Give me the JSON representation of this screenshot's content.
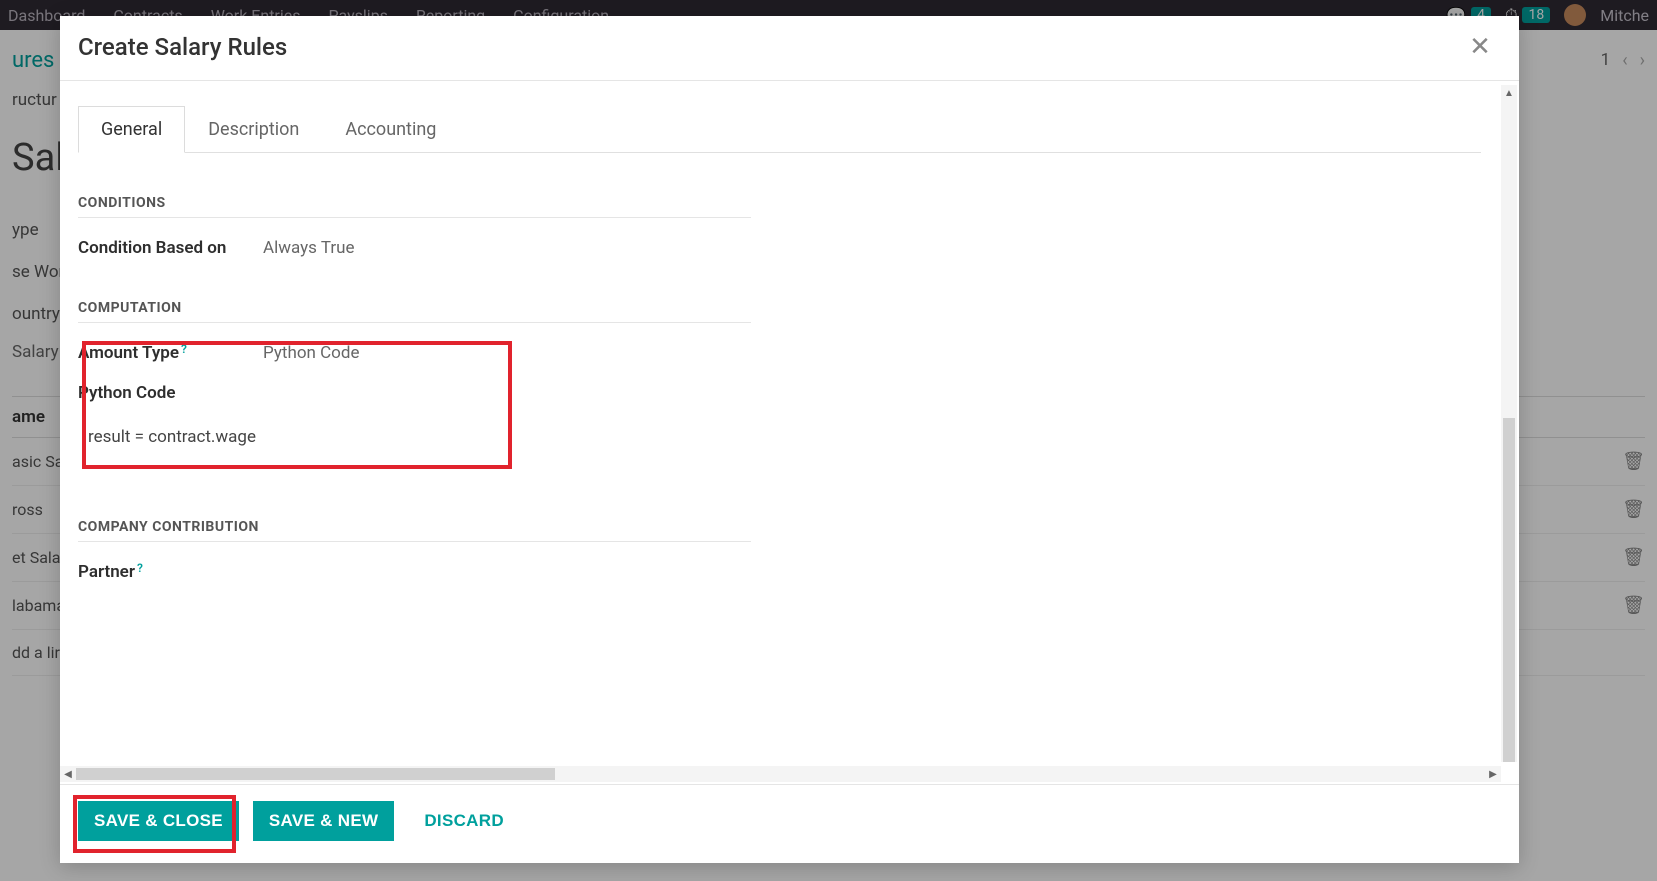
{
  "topnav": {
    "items": [
      "Dashboard",
      "Contracts",
      "Work Entries",
      "Payslips",
      "Reporting",
      "Configuration"
    ],
    "chat_badge": "4",
    "clock_badge": "18",
    "user_name": "Mitche"
  },
  "breadcrumb": {
    "link": "ures",
    "pager_page": "1"
  },
  "bg": {
    "labels": [
      "ructur",
      "",
      "ype",
      "se Wor",
      "ountry"
    ],
    "title_fragment": "Sala",
    "col_header_left": "ame",
    "salary_header_fragment": "Salary",
    "rows": [
      "asic Sa",
      "ross",
      "et Sala",
      "labama",
      "dd a lir"
    ]
  },
  "modal": {
    "title": "Create Salary Rules",
    "tabs": [
      "General",
      "Description",
      "Accounting"
    ],
    "section_conditions": "CONDITIONS",
    "condition_label": "Condition Based on",
    "condition_value": "Always True",
    "section_computation": "COMPUTATION",
    "amount_type_label": "Amount Type",
    "amount_type_value": "Python Code",
    "python_code_label": "Python Code",
    "python_code_value": "result = contract.wage",
    "section_company": "COMPANY CONTRIBUTION",
    "partner_label": "Partner",
    "footer": {
      "save_close": "SAVE & CLOSE",
      "save_new": "SAVE & NEW",
      "discard": "DISCARD"
    }
  }
}
